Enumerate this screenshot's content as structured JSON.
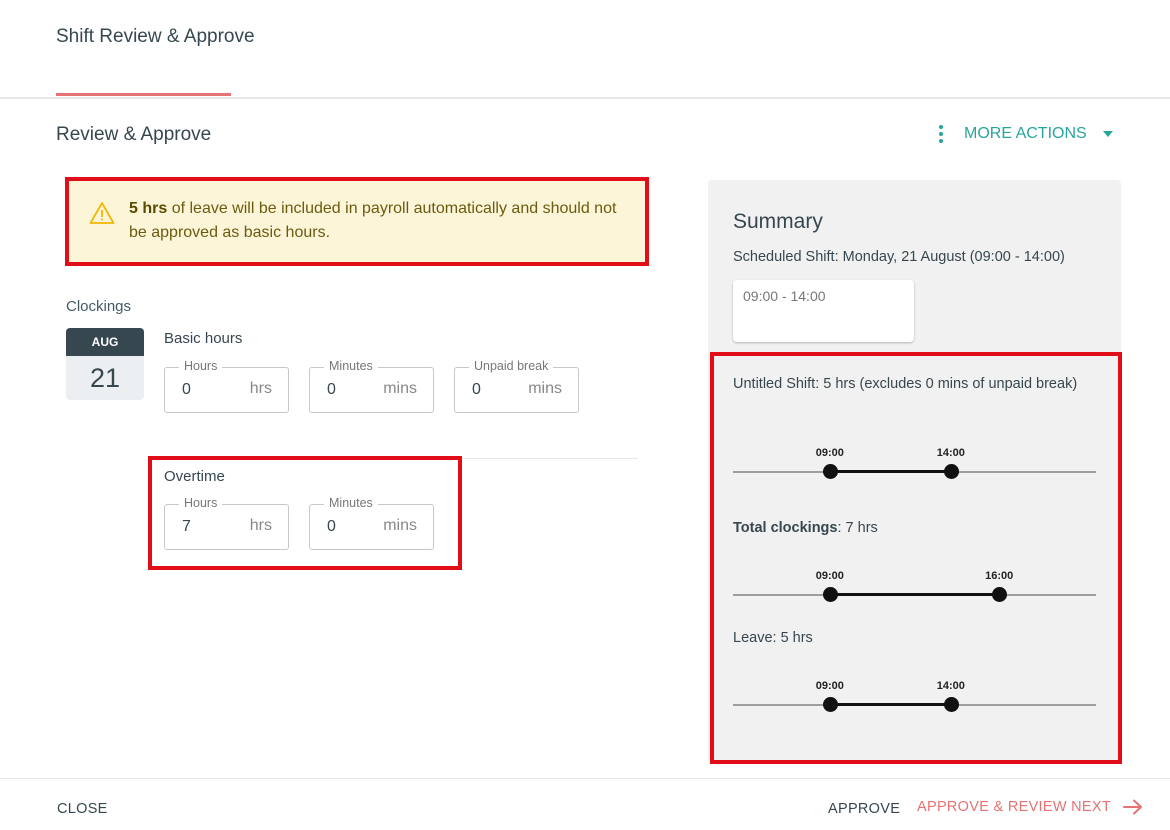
{
  "header": {
    "title": "Shift Review & Approve"
  },
  "section": {
    "title": "Review & Approve",
    "more_actions_label": "MORE ACTIONS"
  },
  "warning": {
    "highlight": "5 hrs",
    "message": " of leave will be included in payroll automatically and should not be approved as basic hours."
  },
  "clockings": {
    "label": "Clockings",
    "date_month": "AUG",
    "date_day": "21",
    "basic": {
      "label": "Basic hours",
      "fields": [
        {
          "legend": "Hours",
          "value": "0",
          "unit": "hrs"
        },
        {
          "legend": "Minutes",
          "value": "0",
          "unit": "mins"
        },
        {
          "legend": "Unpaid break",
          "value": "0",
          "unit": "mins"
        }
      ]
    },
    "overtime": {
      "label": "Overtime",
      "fields": [
        {
          "legend": "Hours",
          "value": "7",
          "unit": "hrs"
        },
        {
          "legend": "Minutes",
          "value": "0",
          "unit": "mins"
        }
      ]
    }
  },
  "summary": {
    "title": "Summary",
    "scheduled": "Scheduled Shift: Monday, 21 August (09:00 - 14:00)",
    "shift_chip": "09:00 - 14:00",
    "shift_line": "Untitled Shift: 5 hrs (excludes 0 mins of unpaid break)",
    "total_label": "Total clockings",
    "total_value": ": 7 hrs",
    "leave_line": "Leave: 5 hrs",
    "timelines": [
      {
        "start": "09:00",
        "end": "14:00"
      },
      {
        "start": "09:00",
        "end": "16:00"
      },
      {
        "start": "09:00",
        "end": "14:00"
      }
    ]
  },
  "footer": {
    "close_label": "CLOSE",
    "approve_label": "APPROVE",
    "approve_next_label": "APPROVE & REVIEW NEXT"
  },
  "colors": {
    "accent": "#26a69a",
    "primary": "#e57373",
    "annotation": "#e20e17",
    "warning_bg": "#fdf5d8"
  }
}
